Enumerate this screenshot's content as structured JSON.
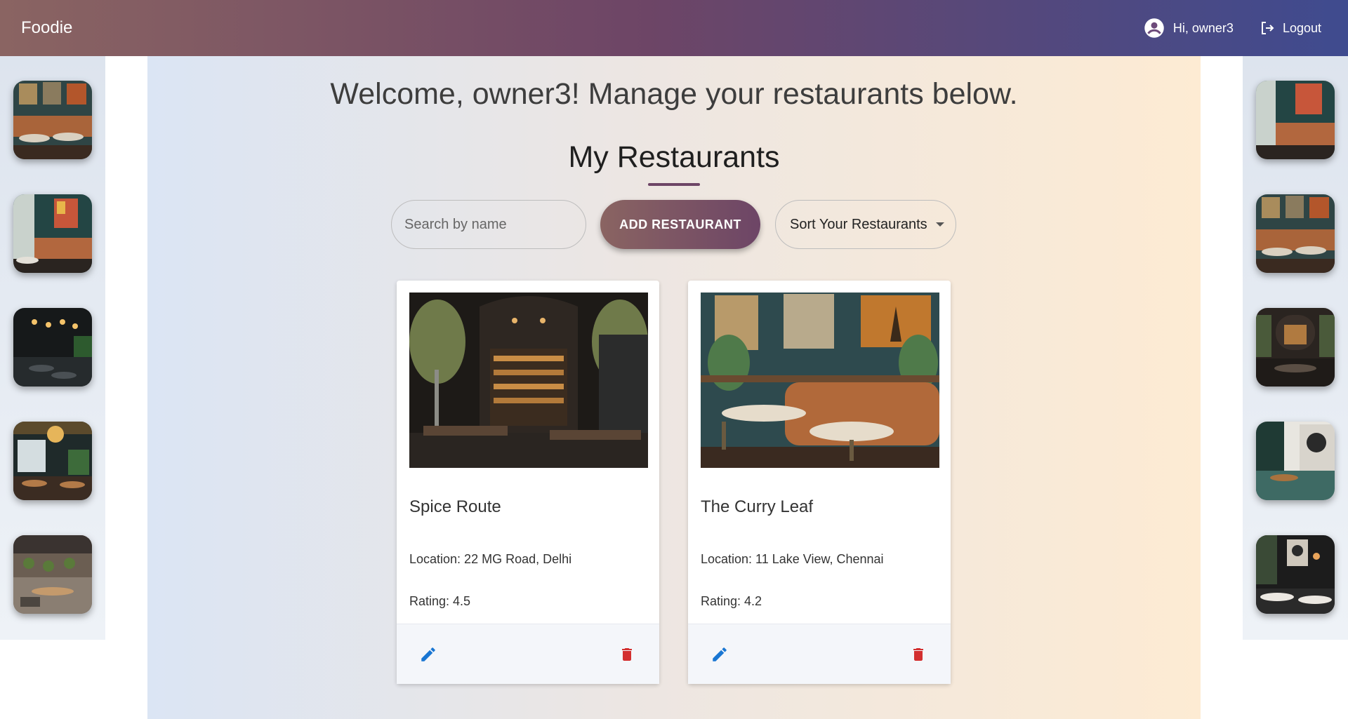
{
  "header": {
    "brand": "Foodie",
    "greeting": "Hi, owner3",
    "logout_label": "Logout"
  },
  "main": {
    "welcome": "Welcome, owner3! Manage your restaurants below.",
    "section_title": "My Restaurants",
    "search_placeholder": "Search by name",
    "add_button_label": "ADD RESTAURANT",
    "sort_label": "Sort Your Restaurants"
  },
  "restaurants": [
    {
      "name": "Spice Route",
      "location": "Location: 22 MG Road, Delhi",
      "rating": "Rating: 4.5"
    },
    {
      "name": "The Curry Leaf",
      "location": "Location: 11 Lake View, Chennai",
      "rating": "Rating: 4.2"
    }
  ],
  "colors": {
    "header_start": "#8a6462",
    "header_mid": "#6d4566",
    "header_end": "#3f4b8f",
    "edit_icon": "#1976d2",
    "delete_icon": "#d32f2f"
  },
  "icons": {
    "user": "account-circle-icon",
    "logout": "logout-icon",
    "edit": "pencil-icon",
    "delete": "trash-icon",
    "sort": "caret-down-icon"
  }
}
